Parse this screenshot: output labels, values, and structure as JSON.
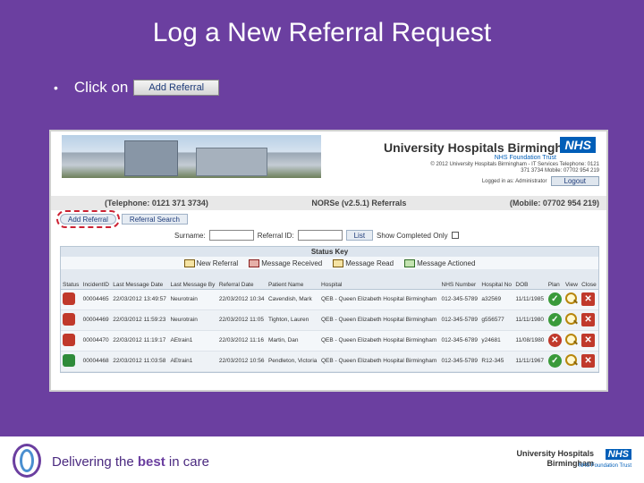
{
  "slide": {
    "title": "Log a New Referral Request",
    "bullet_text": "Click on",
    "button_label": "Add Referral"
  },
  "app": {
    "org_name": "University Hospitals Birmingham",
    "nhs_label": "NHS",
    "trust_label": "NHS Foundation Trust",
    "copyright": "© 2012 University Hospitals Birmingham - IT Services Telephone: 0121 371 3734 Mobile: 07702 954 219",
    "logged_in": "Logged in as: Administrator",
    "logout_label": "Logout",
    "telephone": "(Telephone: 0121 371 3734)",
    "system_name": "NORSe (v2.5.1) Referrals",
    "mobile": "(Mobile: 07702 954 219)",
    "add_referral_label": "Add Referral",
    "referral_search_label": "Referral Search",
    "surname_label": "Surname:",
    "referral_id_label": "Referral ID:",
    "list_button": "List",
    "show_completed_label": "Show Completed Only"
  },
  "status_key": {
    "title": "Status Key",
    "items": [
      "New Referral",
      "Message Received",
      "Message Read",
      "Message Actioned"
    ]
  },
  "table": {
    "headers": [
      "Status",
      "IncidentID",
      "Last Message Date",
      "Last Message By",
      "Referral Date",
      "Patient Name",
      "Hospital",
      "NHS Number",
      "Hospital No",
      "DOB",
      "Plan",
      "View",
      "Close"
    ],
    "rows": [
      {
        "incident": "00004465",
        "last_date": "22/03/2012 13:49:57",
        "last_by": "Neurotrain",
        "ref_date": "22/03/2012 10:34",
        "patient": "Cavendish, Mark",
        "hospital": "QEB - Queen Elizabeth Hospital Birmingham",
        "nhs": "012-345-5789",
        "hosp_no": "a32569",
        "dob": "11/11/1985",
        "status": "red",
        "plan": "ok"
      },
      {
        "incident": "00004469",
        "last_date": "22/03/2012 11:59:23",
        "last_by": "Neurotrain",
        "ref_date": "22/03/2012 11:05",
        "patient": "Tighton, Lauren",
        "hospital": "QEB - Queen Elizabeth Hospital Birmingham",
        "nhs": "012-345-5789",
        "hosp_no": "g556577",
        "dob": "11/11/1980",
        "status": "red",
        "plan": "ok"
      },
      {
        "incident": "00004470",
        "last_date": "22/03/2012 11:19:17",
        "last_by": "AEtrain1",
        "ref_date": "22/03/2012 11:16",
        "patient": "Martin, Dan",
        "hospital": "QEB - Queen Elizabeth Hospital Birmingham",
        "nhs": "012-345-6789",
        "hosp_no": "y24681",
        "dob": "11/08/1980",
        "status": "red",
        "plan": "x"
      },
      {
        "incident": "00004468",
        "last_date": "22/03/2012 11:03:58",
        "last_by": "AEtrain1",
        "ref_date": "22/03/2012 10:56",
        "patient": "Pendleton, Victoria",
        "hospital": "QEB - Queen Elizabeth Hospital Birmingham",
        "nhs": "012-345-5789",
        "hosp_no": "R12-345",
        "dob": "11/11/1967",
        "status": "green",
        "plan": "ok"
      }
    ]
  },
  "footer": {
    "tagline_prefix": "Delivering the ",
    "tagline_bold": "best",
    "tagline_suffix": " in care",
    "org_line1": "University Hospitals",
    "org_line2": "Birmingham",
    "nhs_label": "NHS",
    "trust_label": "NHS Foundation Trust"
  },
  "colors": {
    "slide_bg": "#6b3fa0",
    "nhs_blue": "#005eb8",
    "alert_red": "#c0392b",
    "ok_green": "#3a9a3a"
  }
}
